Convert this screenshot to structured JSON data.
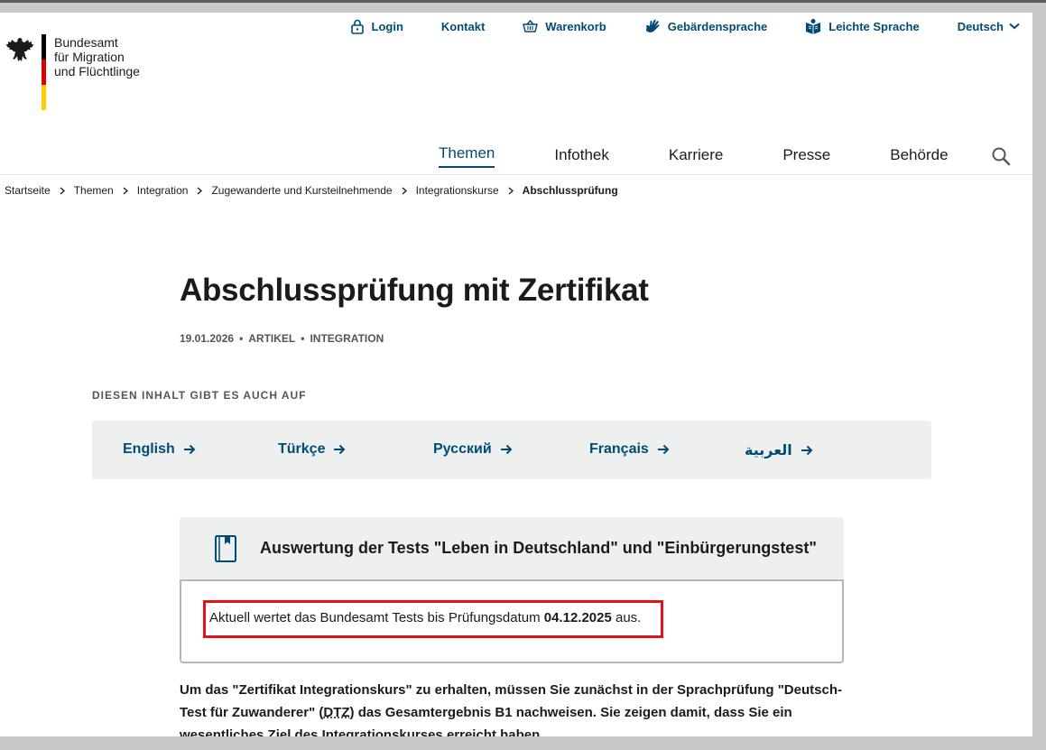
{
  "logo": {
    "line1": "Bundesamt",
    "line2": "für Migration",
    "line3": "und Flüchtlinge"
  },
  "metanav": {
    "login": "Login",
    "kontakt": "Kontakt",
    "warenkorb": "Warenkorb",
    "gebaerden": "Gebärdensprache",
    "leichte": "Leichte Sprache",
    "sprache": "Deutsch"
  },
  "mainnav": {
    "items": [
      "Themen",
      "Infothek",
      "Karriere",
      "Presse",
      "Behörde"
    ],
    "active": "Themen"
  },
  "breadcrumb": [
    "Startseite",
    "Themen",
    "Integration",
    "Zugewanderte und Kursteilnehmende",
    "Integrationskurse",
    "Abschlussprüfung"
  ],
  "article": {
    "title": "Abschlussprüfung mit Zertifikat",
    "date": "19.01.2026",
    "type": "ARTIKEL",
    "category": "INTEGRATION"
  },
  "languages": {
    "heading": "DIESEN INHALT GIBT ES AUCH AUF",
    "items": [
      "English",
      "Türkçe",
      "Русский",
      "Français",
      "العربية"
    ]
  },
  "infobox": {
    "title": "Auswertung der Tests \"Leben in Deutschland\" und \"Einbürgerungstest\"",
    "text_before": "Aktuell wertet das Bundesamt Tests bis Prüfungsdatum",
    "date": "04.12.2025",
    "text_after": "aus."
  },
  "body": {
    "part1": "Um das \"Zertifikat Integrationskurs\" zu erhalten, müssen Sie zunächst in der Sprachprüfung \"Deutsch-Test für Zuwanderer\" (",
    "abbr": "DTZ",
    "part2": ") das Gesamtergebnis B1 nachweisen. Sie zeigen damit, dass Sie ein wesentliches Ziel des Integrationskurses erreicht haben."
  },
  "colors": {
    "brand": "#004b76",
    "highlight": "#e2141b",
    "box_bg": "#eef0f0"
  }
}
